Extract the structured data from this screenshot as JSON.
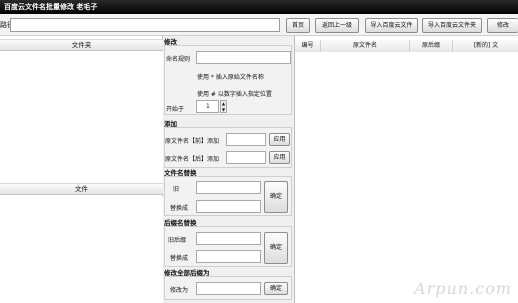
{
  "window": {
    "title": "百度云文件名批量修改 老毛子"
  },
  "toolbar": {
    "path_label": "路径",
    "path_value": "",
    "buttons": [
      "首页",
      "返回上一级",
      "导入百度云文件",
      "导入百度云文件夹",
      "修改"
    ]
  },
  "left": {
    "folder_header": "文件夹",
    "file_header": "文件"
  },
  "modify": {
    "section": "修改",
    "name_rule_label": "命名规则",
    "hint1": "使用 * 插入原始文件名称",
    "hint2": "使用 # 以数字插入指定位置",
    "start_label": "开始于",
    "start_value": "1"
  },
  "add": {
    "section": "添加",
    "prefix_label": "原文件名【前】添加",
    "suffix_label": "原文件名【后】添加",
    "apply_label": "应用"
  },
  "replace": {
    "section": "文件名替换",
    "old_label": "旧",
    "new_label": "替换成",
    "ok_label": "确定"
  },
  "ext_replace": {
    "section": "后缀名替换",
    "old_label": "旧后缀",
    "new_label": "替换成",
    "ok_label": "确定"
  },
  "ext_all": {
    "section": "修改全部后缀为",
    "label": "修改为",
    "ok_label": "确定"
  },
  "list": {
    "columns": [
      "编号",
      "原文件名",
      "原后缀",
      "[新的] 文"
    ]
  },
  "watermark": "Arpun.com"
}
